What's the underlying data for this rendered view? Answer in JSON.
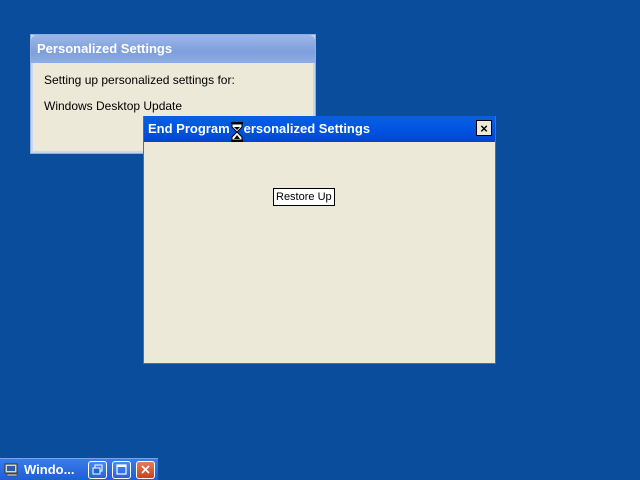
{
  "background_dialog": {
    "title": "Personalized Settings",
    "line1": "Setting up personalized settings for:",
    "line2": "Windows Desktop Update"
  },
  "end_program_window": {
    "title": "End Program - Personalized Settings",
    "title_visible_left": "End Program",
    "title_visible_right": "ersonalized Settings",
    "close_label": "×",
    "restore_button_label": "Restore Up"
  },
  "minimized_window": {
    "title": "Windo..."
  },
  "colors": {
    "desktop": "#0a4d9c",
    "title_active": "#0054e3",
    "title_inactive": "#8eaee6",
    "dialog_face": "#ece9d8"
  }
}
